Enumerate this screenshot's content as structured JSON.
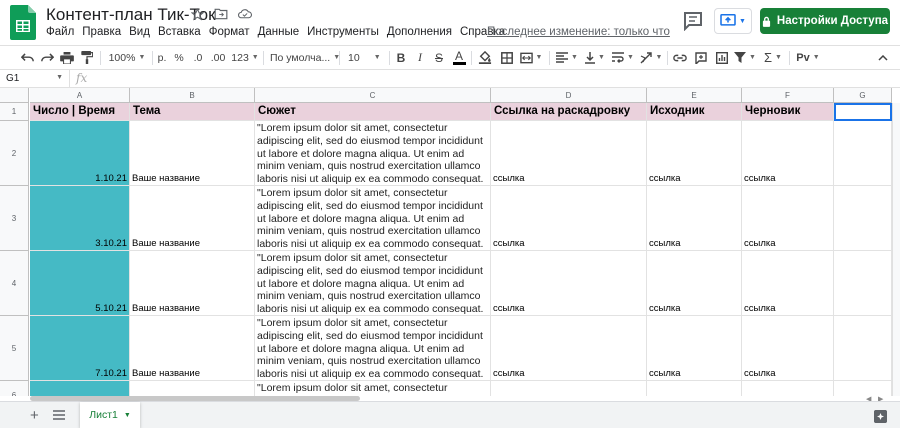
{
  "header": {
    "title": "Контент-план Тик-Ток",
    "menu": [
      "Файл",
      "Правка",
      "Вид",
      "Вставка",
      "Формат",
      "Данные",
      "Инструменты",
      "Дополнения",
      "Справка"
    ],
    "last_edit": "Последнее изменение: только что",
    "share_label": "Настройки Доступа"
  },
  "toolbar": {
    "zoom": "100%",
    "currency": "р.",
    "percent": "%",
    "dec_less": ".0",
    "dec_more": ".00",
    "more_formats": "123",
    "font": "По умолча...",
    "font_size": "10",
    "bold": "B",
    "italic": "I",
    "strike": "S",
    "text_color": "A",
    "sigma": "Σ",
    "input_tools": "Рv"
  },
  "formula_bar": {
    "cell_ref": "G1",
    "fx": "fx",
    "value": ""
  },
  "grid": {
    "columns": [
      "A",
      "B",
      "C",
      "D",
      "E",
      "F",
      "G"
    ],
    "row_numbers": [
      "1",
      "2",
      "3",
      "4",
      "5",
      "6"
    ],
    "headers": [
      "Число | Время",
      "Тема",
      "Сюжет",
      "Ссылка на раскадровку",
      "Исходник",
      "Черновик"
    ],
    "rows": [
      {
        "date": "1.10.21",
        "topic": "Ваше название",
        "plot": "\"Lorem ipsum dolor sit amet, consectetur\nadipiscing elit, sed do eiusmod tempor incididunt\nut labore et dolore magna aliqua. Ut enim ad\nminim veniam, quis nostrud exercitation ullamco\nlaboris nisi ut aliquip ex ea commodo consequat.",
        "link": "ссылка",
        "source": "ссылка",
        "draft": "ссылка"
      },
      {
        "date": "3.10.21",
        "topic": "Ваше название",
        "plot": "\"Lorem ipsum dolor sit amet, consectetur\nadipiscing elit, sed do eiusmod tempor incididunt\nut labore et dolore magna aliqua. Ut enim ad\nminim veniam, quis nostrud exercitation ullamco\nlaboris nisi ut aliquip ex ea commodo consequat.",
        "link": "ссылка",
        "source": "ссылка",
        "draft": "ссылка"
      },
      {
        "date": "5.10.21",
        "topic": "Ваше название",
        "plot": "\"Lorem ipsum dolor sit amet, consectetur\nadipiscing elit, sed do eiusmod tempor incididunt\nut labore et dolore magna aliqua. Ut enim ad\nminim veniam, quis nostrud exercitation ullamco\nlaboris nisi ut aliquip ex ea commodo consequat.",
        "link": "ссылка",
        "source": "ссылка",
        "draft": "ссылка"
      },
      {
        "date": "7.10.21",
        "topic": "Ваше название",
        "plot": "\"Lorem ipsum dolor sit amet, consectetur\nadipiscing elit, sed do eiusmod tempor incididunt\nut labore et dolore magna aliqua. Ut enim ad\nminim veniam, quis nostrud exercitation ullamco\nlaboris nisi ut aliquip ex ea commodo consequat.",
        "link": "ссылка",
        "source": "ссылка",
        "draft": "ссылка"
      },
      {
        "date": "",
        "topic": "",
        "plot": "\"Lorem ipsum dolor sit amet, consectetur",
        "link": "",
        "source": "",
        "draft": ""
      }
    ]
  },
  "sheets": {
    "tabs": [
      "Лист1"
    ]
  },
  "colors": {
    "brand_green": "#188038",
    "header_pink": "#ead1dc",
    "teal": "#45bac5",
    "selection": "#1a73e8"
  }
}
